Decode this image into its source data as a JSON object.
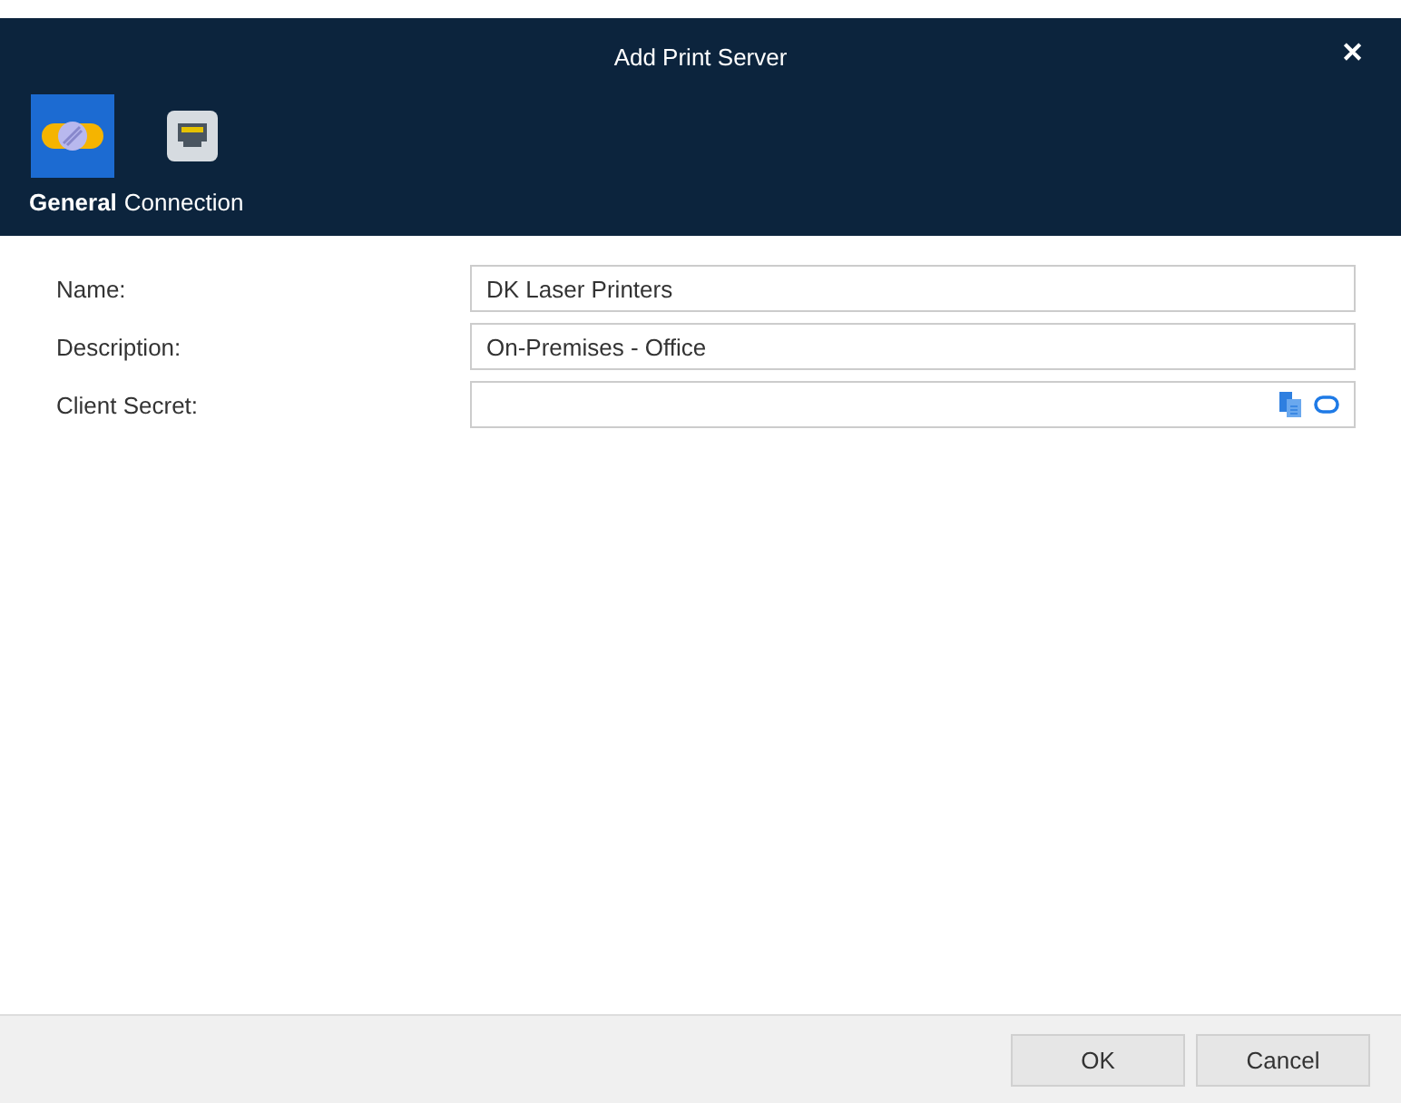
{
  "window": {
    "title": "Add Print Server",
    "close": "✕"
  },
  "tabs": [
    {
      "label": "General",
      "kind": "general",
      "selected": true
    },
    {
      "label": "Connection",
      "kind": "connection",
      "selected": false
    }
  ],
  "fields": [
    {
      "label": "Name:",
      "value": "DK Laser Printers",
      "kind": "text"
    },
    {
      "label": "Description:",
      "value": "On-Premises - Office",
      "kind": "text"
    },
    {
      "label": "Client Secret:",
      "kind": "secret"
    }
  ],
  "buttons": [
    "OK",
    "Cancel"
  ]
}
